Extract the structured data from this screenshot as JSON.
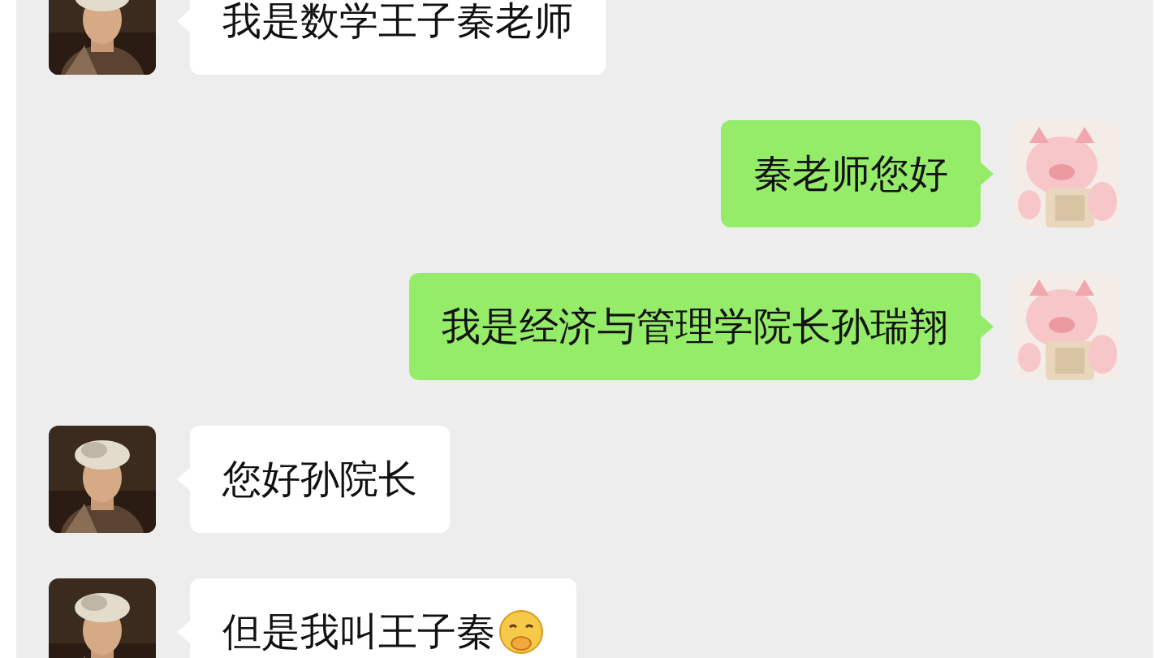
{
  "messages": [
    {
      "kind": "incoming",
      "text": "我是数学王子秦老师",
      "emoji": false
    },
    {
      "kind": "outgoing",
      "text": "秦老师您好",
      "emoji": false
    },
    {
      "kind": "outgoing",
      "text": "我是经济与管理学院长孙瑞翔",
      "emoji": false
    },
    {
      "kind": "incoming",
      "text": "您好孙院长",
      "emoji": false
    },
    {
      "kind": "incoming",
      "text": "但是我叫王子秦",
      "emoji": true
    }
  ]
}
